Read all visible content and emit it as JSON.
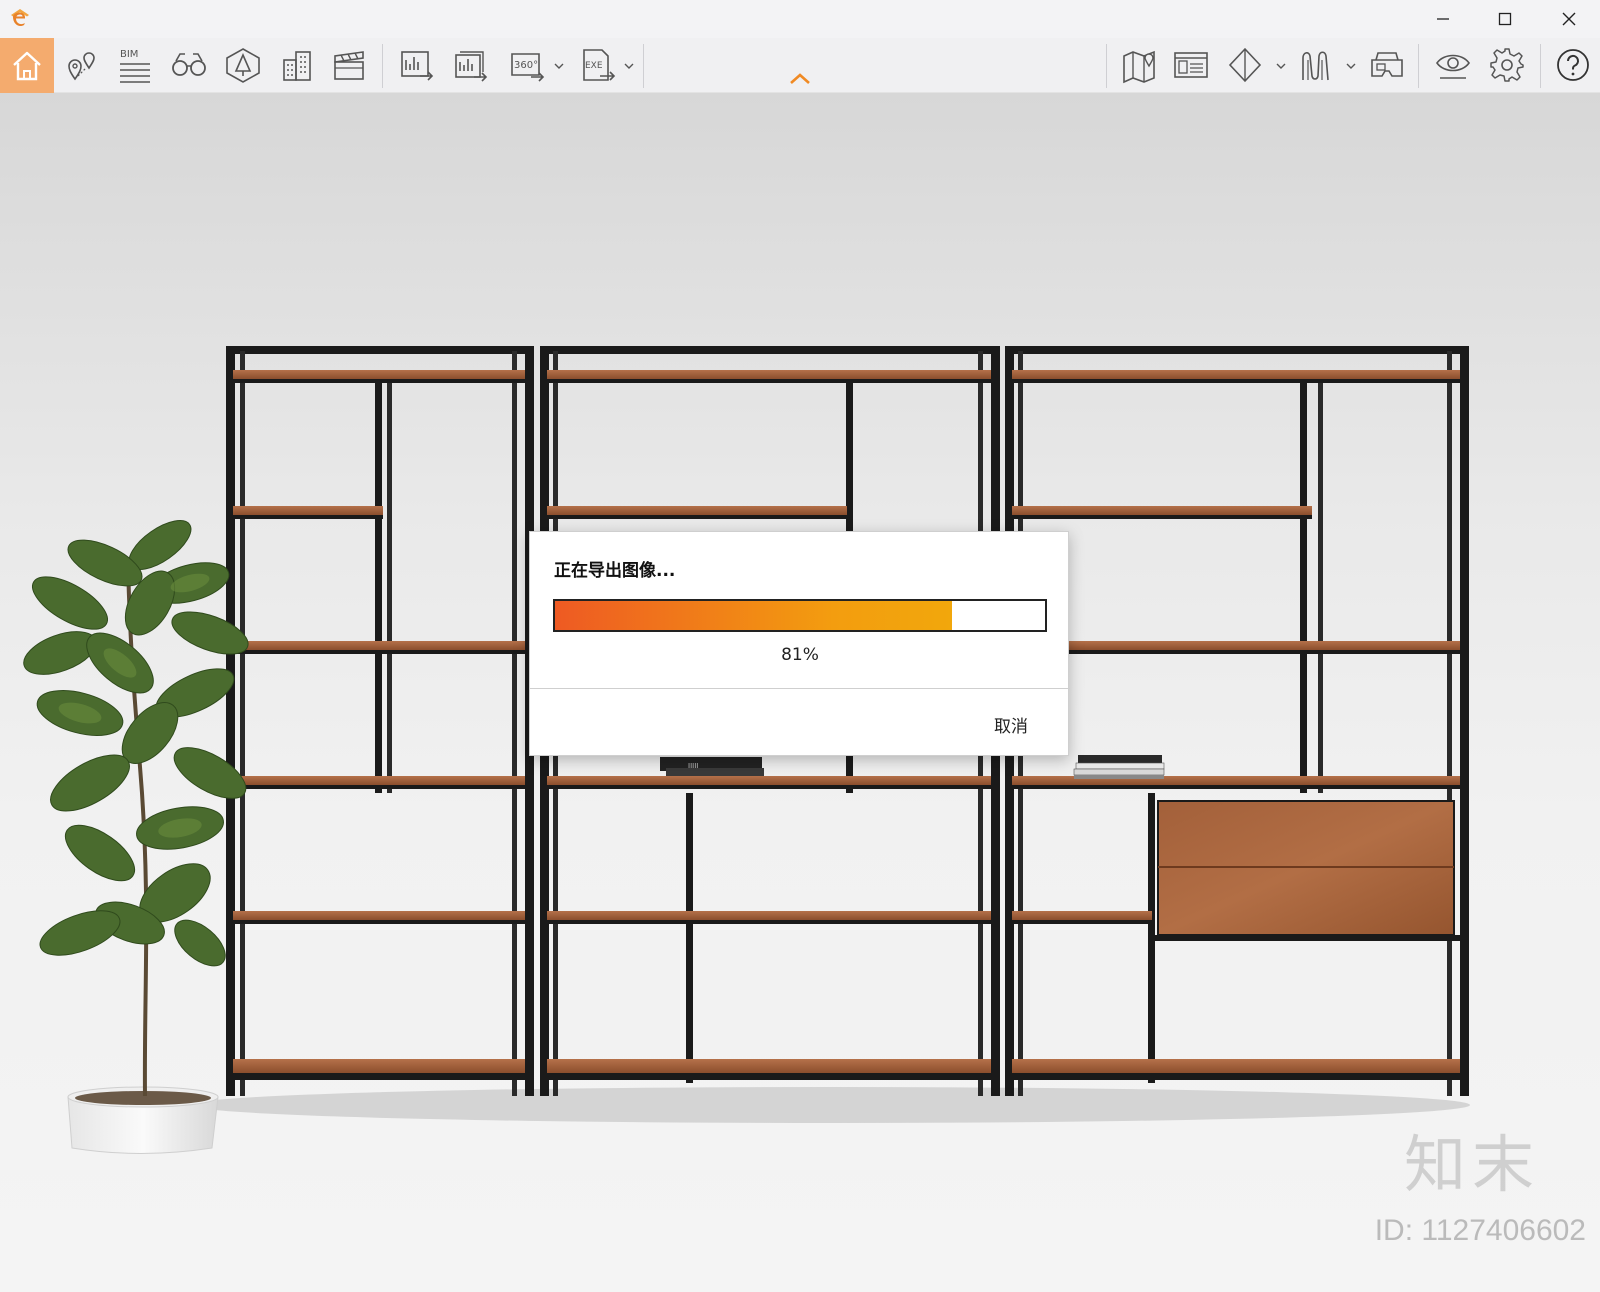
{
  "window": {
    "controls": [
      "minimize",
      "maximize",
      "close"
    ]
  },
  "toolbar": {
    "left_tools": [
      {
        "name": "home-icon"
      },
      {
        "name": "location-pins-icon"
      },
      {
        "name": "bim-icon",
        "label": "BIM"
      },
      {
        "name": "binoculars-icon"
      },
      {
        "name": "light-icon"
      },
      {
        "name": "buildings-icon"
      },
      {
        "name": "clapperboard-icon"
      },
      {
        "name": "export-image-icon"
      },
      {
        "name": "batch-export-icon"
      },
      {
        "name": "panorama-360-icon",
        "label": "360°"
      },
      {
        "name": "export-exe-icon",
        "label": "EXE"
      }
    ],
    "right_tools": [
      {
        "name": "map-icon"
      },
      {
        "name": "screen-icon"
      },
      {
        "name": "cube-icon"
      },
      {
        "name": "stroke-path-icon"
      },
      {
        "name": "vr-headset-icon"
      },
      {
        "name": "eye-icon"
      },
      {
        "name": "settings-icon"
      },
      {
        "name": "help-icon"
      }
    ],
    "accent": "#f4ab6e"
  },
  "dialog": {
    "title": "正在导出图像...",
    "progress_fraction": 0.81,
    "percent_text": "81%",
    "cancel_label": "取消"
  },
  "watermark": {
    "logo_text": "知末",
    "id_text": "ID: 1127406602"
  }
}
